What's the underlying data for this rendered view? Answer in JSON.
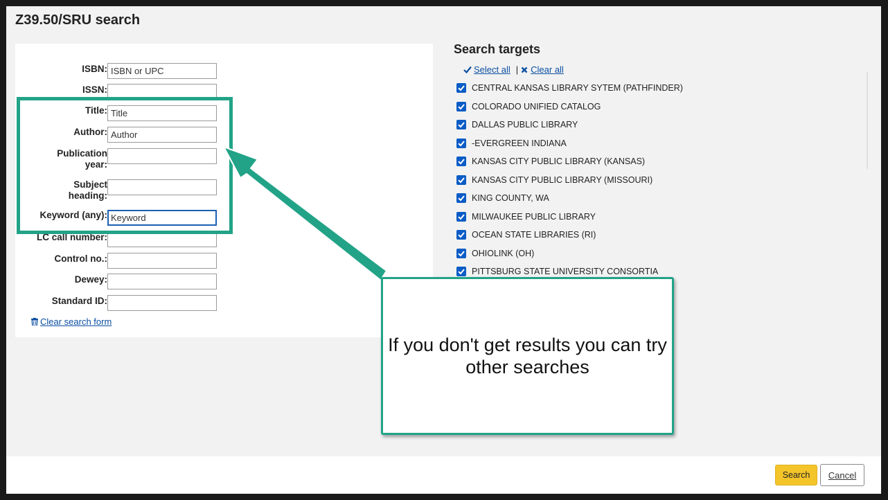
{
  "dialog": {
    "title": "Z39.50/SRU search"
  },
  "form": {
    "fields": [
      {
        "label": "ISBN:",
        "value": "ISBN or UPC"
      },
      {
        "label": "ISSN:",
        "value": ""
      },
      {
        "label": "Title:",
        "value": "Title"
      },
      {
        "label": "Author:",
        "value": "Author"
      },
      {
        "label_line1": "Publication",
        "label_line2": "year:",
        "value": ""
      },
      {
        "label_line1": "Subject",
        "label_line2": "heading:",
        "value": ""
      },
      {
        "label": "Keyword (any):",
        "value": "Keyword"
      },
      {
        "label": "LC call number:",
        "value": ""
      },
      {
        "label": "Control no.:",
        "value": ""
      },
      {
        "label": "Dewey:",
        "value": ""
      },
      {
        "label": "Standard ID:",
        "value": ""
      }
    ],
    "clear_label": "Clear search form"
  },
  "targets": {
    "title": "Search targets",
    "select_all": "Select all",
    "clear_all": "Clear all",
    "separator": "|",
    "items": [
      {
        "label": "CENTRAL KANSAS LIBRARY SYTEM (PATHFINDER)",
        "checked": true
      },
      {
        "label": "COLORADO UNIFIED CATALOG",
        "checked": true
      },
      {
        "label": "DALLAS PUBLIC LIBRARY",
        "checked": true
      },
      {
        "label": "-EVERGREEN INDIANA",
        "checked": true
      },
      {
        "label": "KANSAS CITY PUBLIC LIBRARY (KANSAS)",
        "checked": true
      },
      {
        "label": "KANSAS CITY PUBLIC LIBRARY (MISSOURI)",
        "checked": true
      },
      {
        "label": "KING COUNTY, WA",
        "checked": true
      },
      {
        "label": "MILWAUKEE PUBLIC LIBRARY",
        "checked": true
      },
      {
        "label": "OCEAN STATE LIBRARIES (RI)",
        "checked": true
      },
      {
        "label": "OHIOLINK (OH)",
        "checked": true
      },
      {
        "label": "PITTSBURG STATE UNIVERSITY CONSORTIA",
        "checked": true
      }
    ]
  },
  "footer": {
    "search_label": "Search",
    "cancel_label": "Cancel"
  },
  "annotation": {
    "callout_text": "If you don't get results you can try other searches",
    "accent_color": "#22a387"
  },
  "colors": {
    "link": "#0b4ea2",
    "checkbox": "#0b5cc6",
    "search_button": "#f4c52a"
  },
  "icons": [
    "trash-icon",
    "check-icon",
    "x-icon",
    "arrow-icon"
  ]
}
